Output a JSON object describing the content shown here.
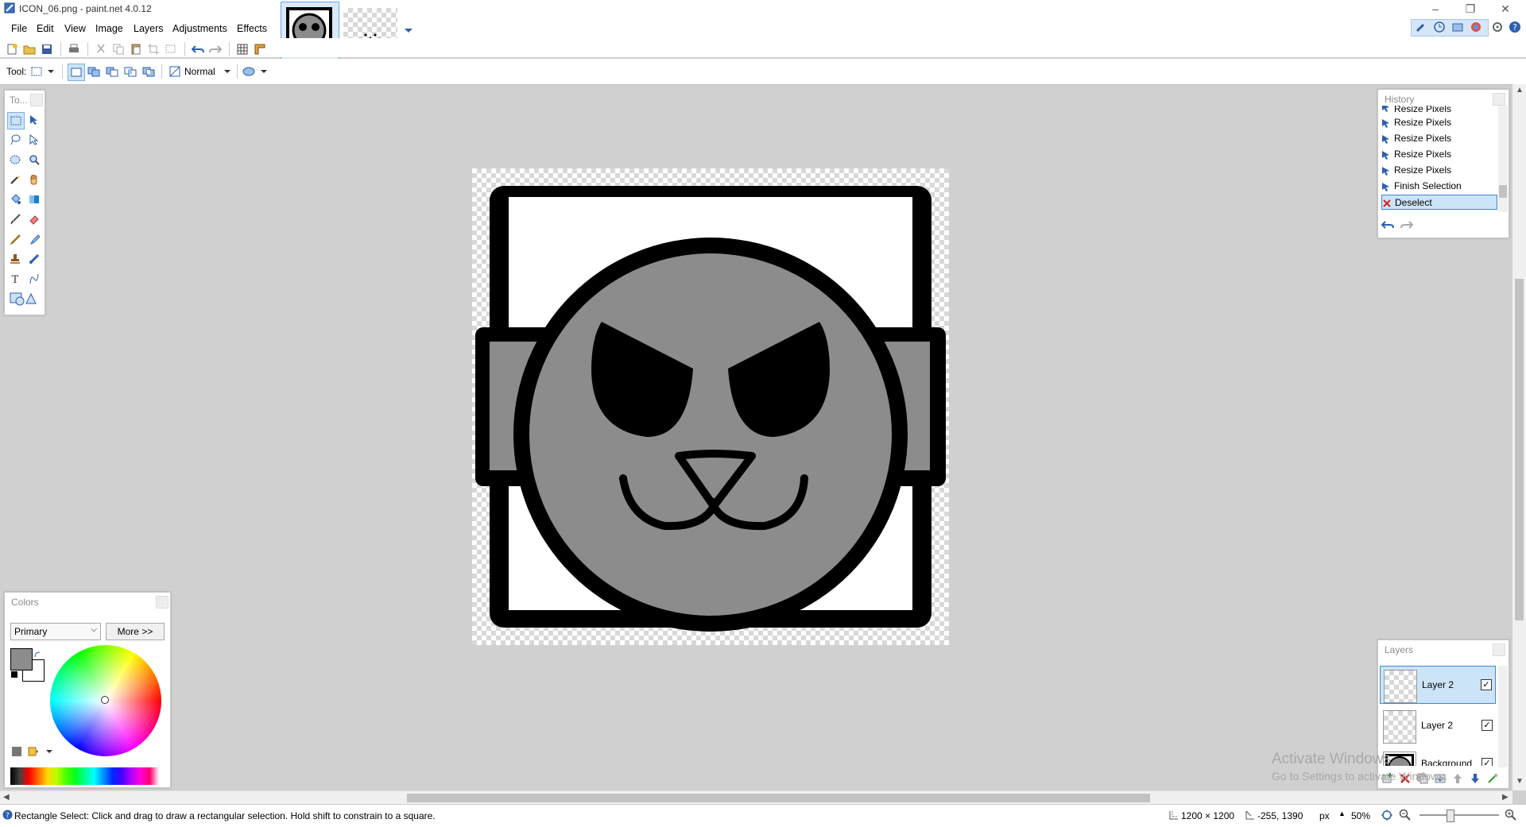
{
  "window": {
    "title": "ICON_06.png - paint.net 4.0.12",
    "minimize_icon": "minimize-icon",
    "restore_icon": "restore-icon",
    "close_icon": "close-icon"
  },
  "menu": {
    "items": [
      "File",
      "Edit",
      "View",
      "Image",
      "Layers",
      "Adjustments",
      "Effects"
    ]
  },
  "toolbar": {
    "tool_label": "Tool:",
    "blend_mode": "Normal"
  },
  "panels": {
    "tools_title": "To...",
    "history": {
      "title": "History",
      "items": [
        {
          "label": "Resize Pixels",
          "icon": "resize-pixels-icon"
        },
        {
          "label": "Resize Pixels",
          "icon": "resize-pixels-icon"
        },
        {
          "label": "Resize Pixels",
          "icon": "resize-pixels-icon"
        },
        {
          "label": "Resize Pixels",
          "icon": "resize-pixels-icon"
        },
        {
          "label": "Resize Pixels",
          "icon": "resize-pixels-icon"
        },
        {
          "label": "Finish Selection",
          "icon": "finish-selection-icon"
        },
        {
          "label": "Deselect",
          "icon": "deselect-icon",
          "selected": true
        }
      ]
    },
    "colors": {
      "title": "Colors",
      "selector": "Primary",
      "more_button": "More >>",
      "primary_color": "#8c8c8c",
      "secondary_color": "#ffffff"
    },
    "layers": {
      "title": "Layers",
      "items": [
        {
          "name": "Layer 2",
          "visible": true,
          "selected": true
        },
        {
          "name": "Layer 2",
          "visible": true,
          "selected": false
        },
        {
          "name": "Background",
          "visible": true,
          "selected": false
        }
      ]
    }
  },
  "status": {
    "hint": "Rectangle Select: Click and drag to draw a rectangular selection. Hold shift to constrain to a square.",
    "image_size": "1200 × 1200",
    "cursor_position": "-255, 1390",
    "unit": "px",
    "zoom": "50%"
  },
  "watermark": {
    "line1": "Activate Windows",
    "line2": "Go to Settings to activate Windows."
  },
  "colors": {
    "selection_blue": "#cce4f7",
    "accent": "#2d5fb0",
    "canvas_bg": "#d0d0d0"
  }
}
